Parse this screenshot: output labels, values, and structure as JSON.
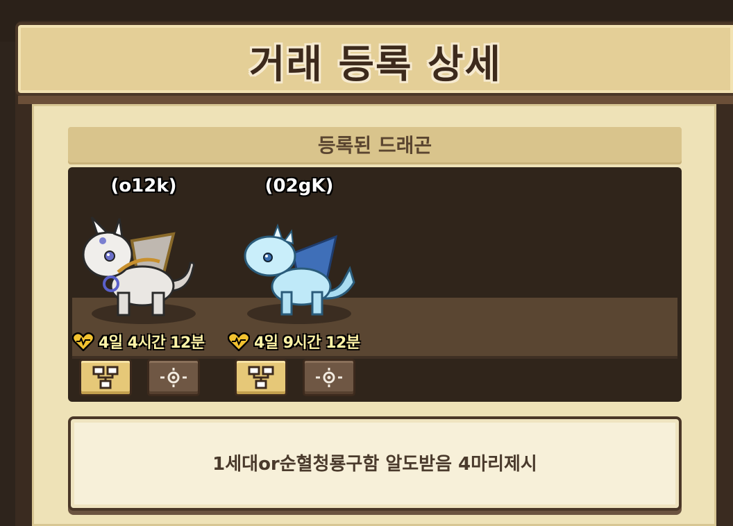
{
  "header": {
    "title": "거래 등록 상세"
  },
  "section": {
    "label": "등록된 드래곤"
  },
  "dragons": [
    {
      "name": "(o12k)",
      "timer": "4일 4시간 12분",
      "variant": "white-gold",
      "buttons": [
        "tree-icon",
        "target-icon"
      ]
    },
    {
      "name": "(02gK)",
      "timer": "4일 9시간 12분",
      "variant": "ice-blue",
      "buttons": [
        "tree-icon",
        "target-icon"
      ]
    }
  ],
  "message": {
    "text": "1세대or순혈청룡구함 알도받음 4마리제시"
  },
  "colors": {
    "panel": "#eee2b7",
    "title_bar": "#e4cf97",
    "dragon_bg": "#30251b",
    "timer_text": "#fff3a6",
    "heart": "#f2c230"
  }
}
